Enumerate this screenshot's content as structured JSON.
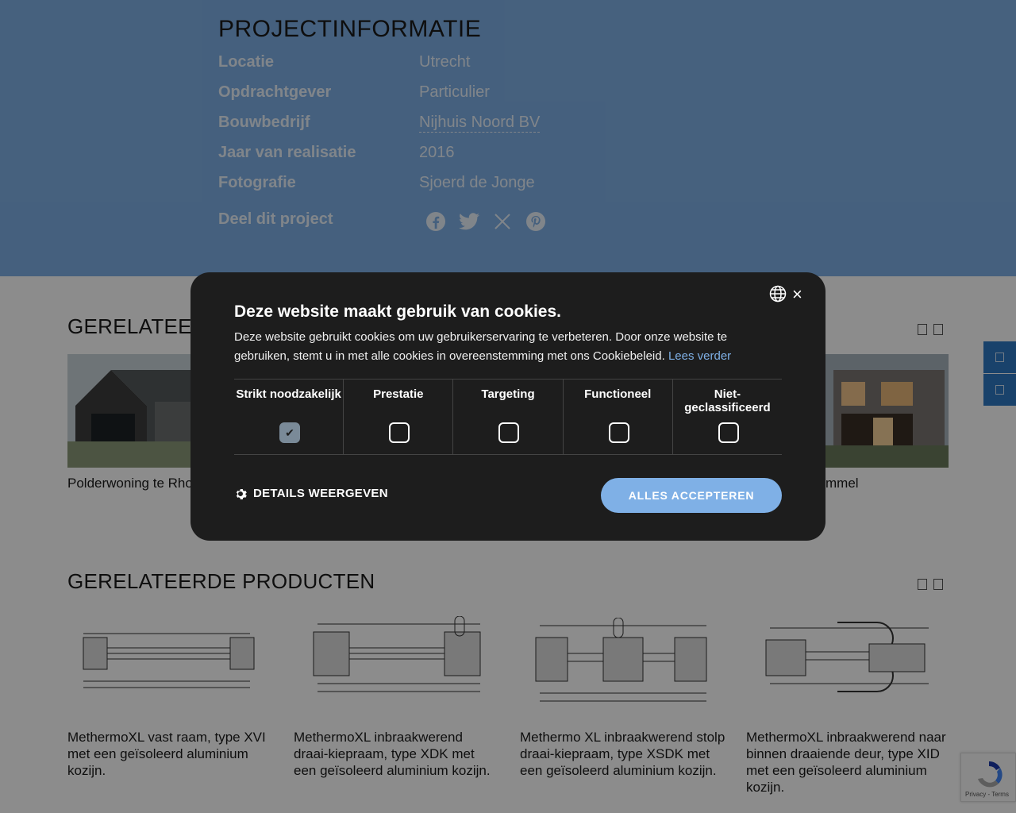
{
  "project": {
    "title": "PROJECTINFORMATIE",
    "rows": [
      {
        "label": "Locatie",
        "value": "Utrecht"
      },
      {
        "label": "Opdrachtgever",
        "value": "Particulier"
      },
      {
        "label": "Bouwbedrijf",
        "value": "Nijhuis Noord BV"
      },
      {
        "label": "Jaar van realisatie",
        "value": "2016"
      },
      {
        "label": "Fotografie",
        "value": "Sjoerd de Jonge"
      }
    ],
    "share_label": "Deel dit project",
    "share_icons": [
      "facebook-icon",
      "twitter-icon",
      "x-icon",
      "pinterest-icon"
    ]
  },
  "related_projects": {
    "title": "GERELATEERD",
    "cards": [
      {
        "caption": "Polderwoning te Rho"
      },
      {
        "caption": "mmel"
      }
    ]
  },
  "related_products": {
    "title": "GERELATEERDE PRODUCTEN",
    "items": [
      {
        "caption": "MethermoXL vast raam, type XVI met een geïsoleerd aluminium kozijn."
      },
      {
        "caption": "MethermoXL inbraakwerend draai-kiepraam, type XDK met een geïsoleerd aluminium kozijn."
      },
      {
        "caption": "Methermo XL inbraakwerend stolp draai-kiepraam, type XSDK met een geïsoleerd aluminium kozijn."
      },
      {
        "caption": "MethermoXL inbraakwerend naar binnen draaiende deur, type XID met een geïsoleerd aluminium kozijn."
      }
    ]
  },
  "cookie": {
    "title": "Deze website maakt gebruik van cookies.",
    "text": "Deze website gebruikt cookies om uw gebruikerservaring te verbeteren. Door onze website te gebruiken, stemt u in met alle cookies in overeenstemming met ons Cookiebeleid.",
    "read_more": "Lees verder",
    "categories": [
      {
        "label": "Strikt noodzakelijk",
        "checked": true
      },
      {
        "label": "Prestatie",
        "checked": false
      },
      {
        "label": "Targeting",
        "checked": false
      },
      {
        "label": "Functioneel",
        "checked": false
      },
      {
        "label": "Niet-geclassificeerd",
        "checked": false
      }
    ],
    "details_label": "DETAILS WEERGEVEN",
    "accept_label": "ALLES ACCEPTEREN",
    "close_glyph": "×"
  },
  "recaptcha": {
    "footer": "Privacy - Terms"
  },
  "colors": {
    "accent": "#7fb0e6",
    "modal_bg": "#1d1d1d"
  }
}
